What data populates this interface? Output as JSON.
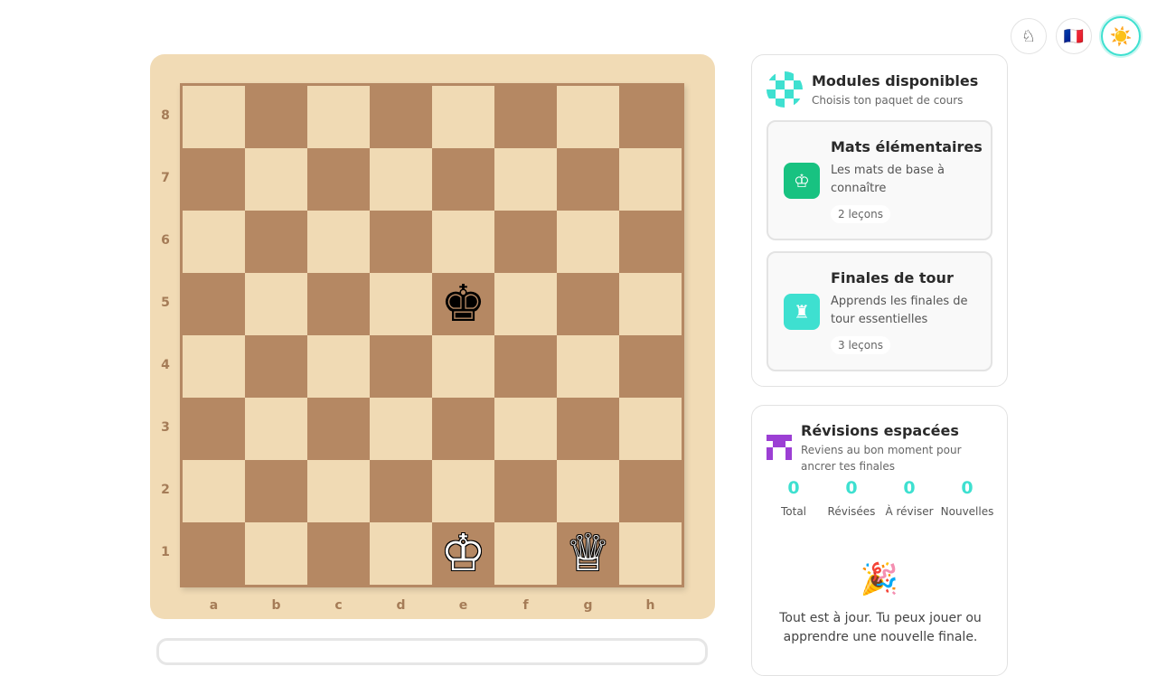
{
  "top_buttons": {
    "history_icon": "♘",
    "flag_icon": "🇫🇷",
    "theme_icon": "☀️"
  },
  "board": {
    "ranks": [
      "8",
      "7",
      "6",
      "5",
      "4",
      "3",
      "2",
      "1"
    ],
    "files": [
      "a",
      "b",
      "c",
      "d",
      "e",
      "f",
      "g",
      "h"
    ],
    "pieces": {
      "e5": {
        "glyph": "♚",
        "color": "black",
        "name": "black-king-icon"
      },
      "e1": {
        "glyph": "♔",
        "color": "white",
        "name": "white-king-icon"
      },
      "g1": {
        "glyph": "♕",
        "color": "white",
        "name": "white-queen-icon"
      }
    },
    "light_color": "#f0dab4",
    "dark_color": "#b58863"
  },
  "modules": {
    "title": "Modules disponibles",
    "subtitle": "Choisis ton paquet de cours",
    "cards": [
      {
        "title": "Mats élémentaires",
        "desc": "Les mats de base à connaître",
        "count": "2 leçons",
        "icon": "♔"
      },
      {
        "title": "Finales de tour",
        "desc": "Apprends les finales de tour essentielles",
        "count": "3 leçons",
        "icon": "♜"
      }
    ]
  },
  "review": {
    "title": "Révisions espacées",
    "subtitle": "Reviens au bon moment pour ancrer tes finales",
    "stats": [
      {
        "value": "0",
        "label": "Total"
      },
      {
        "value": "0",
        "label": "Révisées"
      },
      {
        "value": "0",
        "label": "À réviser"
      },
      {
        "value": "0",
        "label": "Nouvelles"
      }
    ],
    "party_icon": "🎉",
    "done_text": "Tout est à jour. Tu peux jouer ou apprendre une nouvelle finale."
  }
}
